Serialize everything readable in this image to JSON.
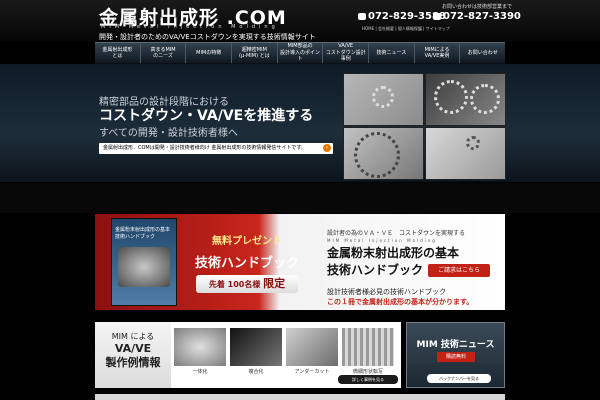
{
  "header": {
    "logo_text": "金属射出成形 .COM",
    "logo_sub": "MIM  Metal Injection Molding",
    "tagline": "開発・設計者のためのVA/VEコストダウンを実現する技術情報サイト",
    "contact_note": "お問い合わせは技術部営業まで",
    "tel": "072-829-3588",
    "fax": "072-827-3390",
    "utility_links": "HOME | 会社概要 | 個人情報保護 | サイトマップ"
  },
  "nav": {
    "items": [
      {
        "label": "金属射出成形\nとは"
      },
      {
        "label": "高まるMIM\nのニーズ"
      },
      {
        "label": "MIMの特徴"
      },
      {
        "label": "超精密MIM\n(μ-MIM) とは"
      },
      {
        "label": "MIM部品の\n設計導入のポイント"
      },
      {
        "label": "VA/VE\nコストダウン設計事例"
      },
      {
        "label": "技術ニュース"
      },
      {
        "label": "MIMによる\nVA/VE実例"
      },
      {
        "label": "お問い合わせ"
      }
    ]
  },
  "hero": {
    "line1": "精密部品の設計段階における",
    "line2": "コストダウン・VA/VEを推進する",
    "line3": "すべての開発・設計技術者様へ",
    "button_label": "金属射出成形．COMは開発・設計技術者様向け 金属射出成形の技術情報発信サイトです。",
    "button_arrow": "›"
  },
  "promo": {
    "book_title": "金属粉末射出成形の基本\n技術ハンドブック",
    "free_label": "無料プレゼント",
    "handbook_label": "技術ハンドブック",
    "limit_prefix": "先着",
    "limit_count": "100",
    "limit_unit": "名様",
    "limit_word": "限定",
    "right_subtitle": "設計者の為のＶＡ・ＶＥ　コストダウンを実現する",
    "right_mim": "MIM  Metal Injection Molding",
    "right_title": "金属粉末射出成形の基本\n技術ハンドブック",
    "request_button": "ご請求はこちら",
    "need_text": "設計技術者様必見の技術ハンドブック",
    "need_highlight": "この１冊で金属射出成形の基本が分かります。"
  },
  "cases": {
    "head_line1": "MIM による",
    "head_line2": "VA/VE",
    "head_line3": "製作例情報",
    "items": [
      {
        "label": "一体化"
      },
      {
        "label": "複合化"
      },
      {
        "label": "アンダーカット"
      },
      {
        "label": "微細形状転写"
      }
    ],
    "detail_button": "詳しく事例を見る"
  },
  "news": {
    "title": "MIM 技術ニュース",
    "badge": "購読無料",
    "back_button": "バックナンバーを見る"
  }
}
